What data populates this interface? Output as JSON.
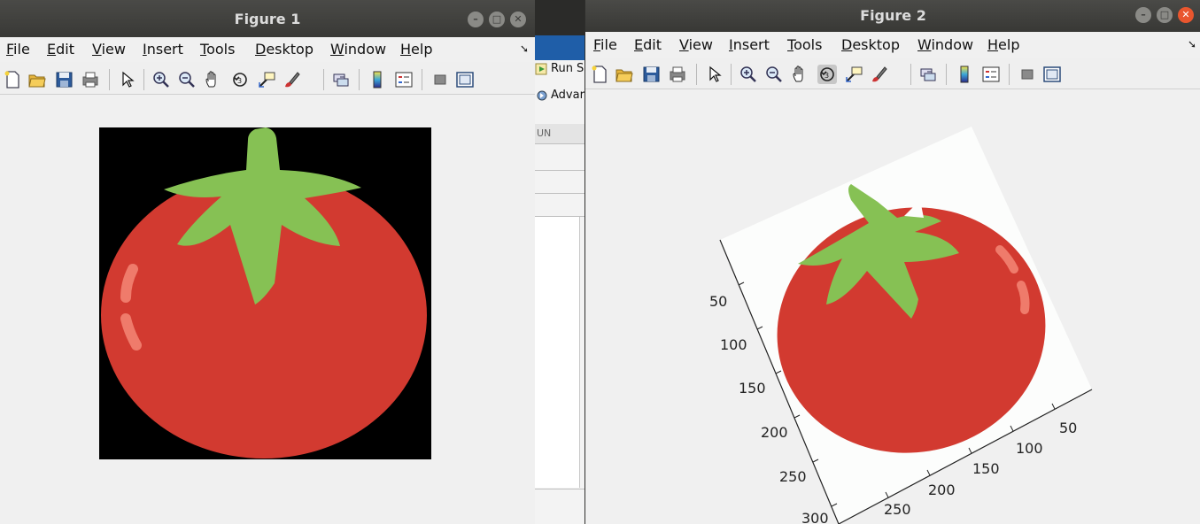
{
  "figure1": {
    "title": "Figure 1",
    "menu": [
      "File",
      "Edit",
      "View",
      "Insert",
      "Tools",
      "Desktop",
      "Window",
      "Help"
    ],
    "mnemonics": [
      "F",
      "E",
      "V",
      "I",
      "T",
      "D",
      "W",
      "H"
    ],
    "menu_rest": [
      "ile",
      "dit",
      "iew",
      "nsert",
      "ools",
      "esktop",
      "indow",
      "elp"
    ]
  },
  "figure2": {
    "title": "Figure 2",
    "menu": [
      "File",
      "Edit",
      "View",
      "Insert",
      "Tools",
      "Desktop",
      "Window",
      "Help"
    ],
    "mnemonics": [
      "F",
      "E",
      "V",
      "I",
      "T",
      "D",
      "W",
      "H"
    ],
    "menu_rest": [
      "ile",
      "dit",
      "iew",
      "nsert",
      "ools",
      "esktop",
      "indow",
      "elp"
    ],
    "y_ticks": [
      "50",
      "100",
      "150",
      "200",
      "250",
      "300"
    ],
    "x_ticks": [
      "50",
      "100",
      "150",
      "200",
      "250"
    ]
  },
  "background_window": {
    "run_label": "Run S",
    "advanced_label": "Advar",
    "section_label": "UN"
  },
  "colors": {
    "tomato_red": "#d23a30",
    "stem_green": "#86c154",
    "highlight": "#ef7b6b"
  },
  "icons": [
    "new-figure-icon",
    "open-file-icon",
    "save-icon",
    "print-icon",
    "pointer-icon",
    "zoom-in-icon",
    "zoom-out-icon",
    "pan-icon",
    "rotate-3d-icon",
    "data-cursor-icon",
    "brush-icon",
    "link-plot-icon",
    "colorbar-icon",
    "legend-icon",
    "hide-plot-tools-icon",
    "show-plot-tools-icon"
  ]
}
